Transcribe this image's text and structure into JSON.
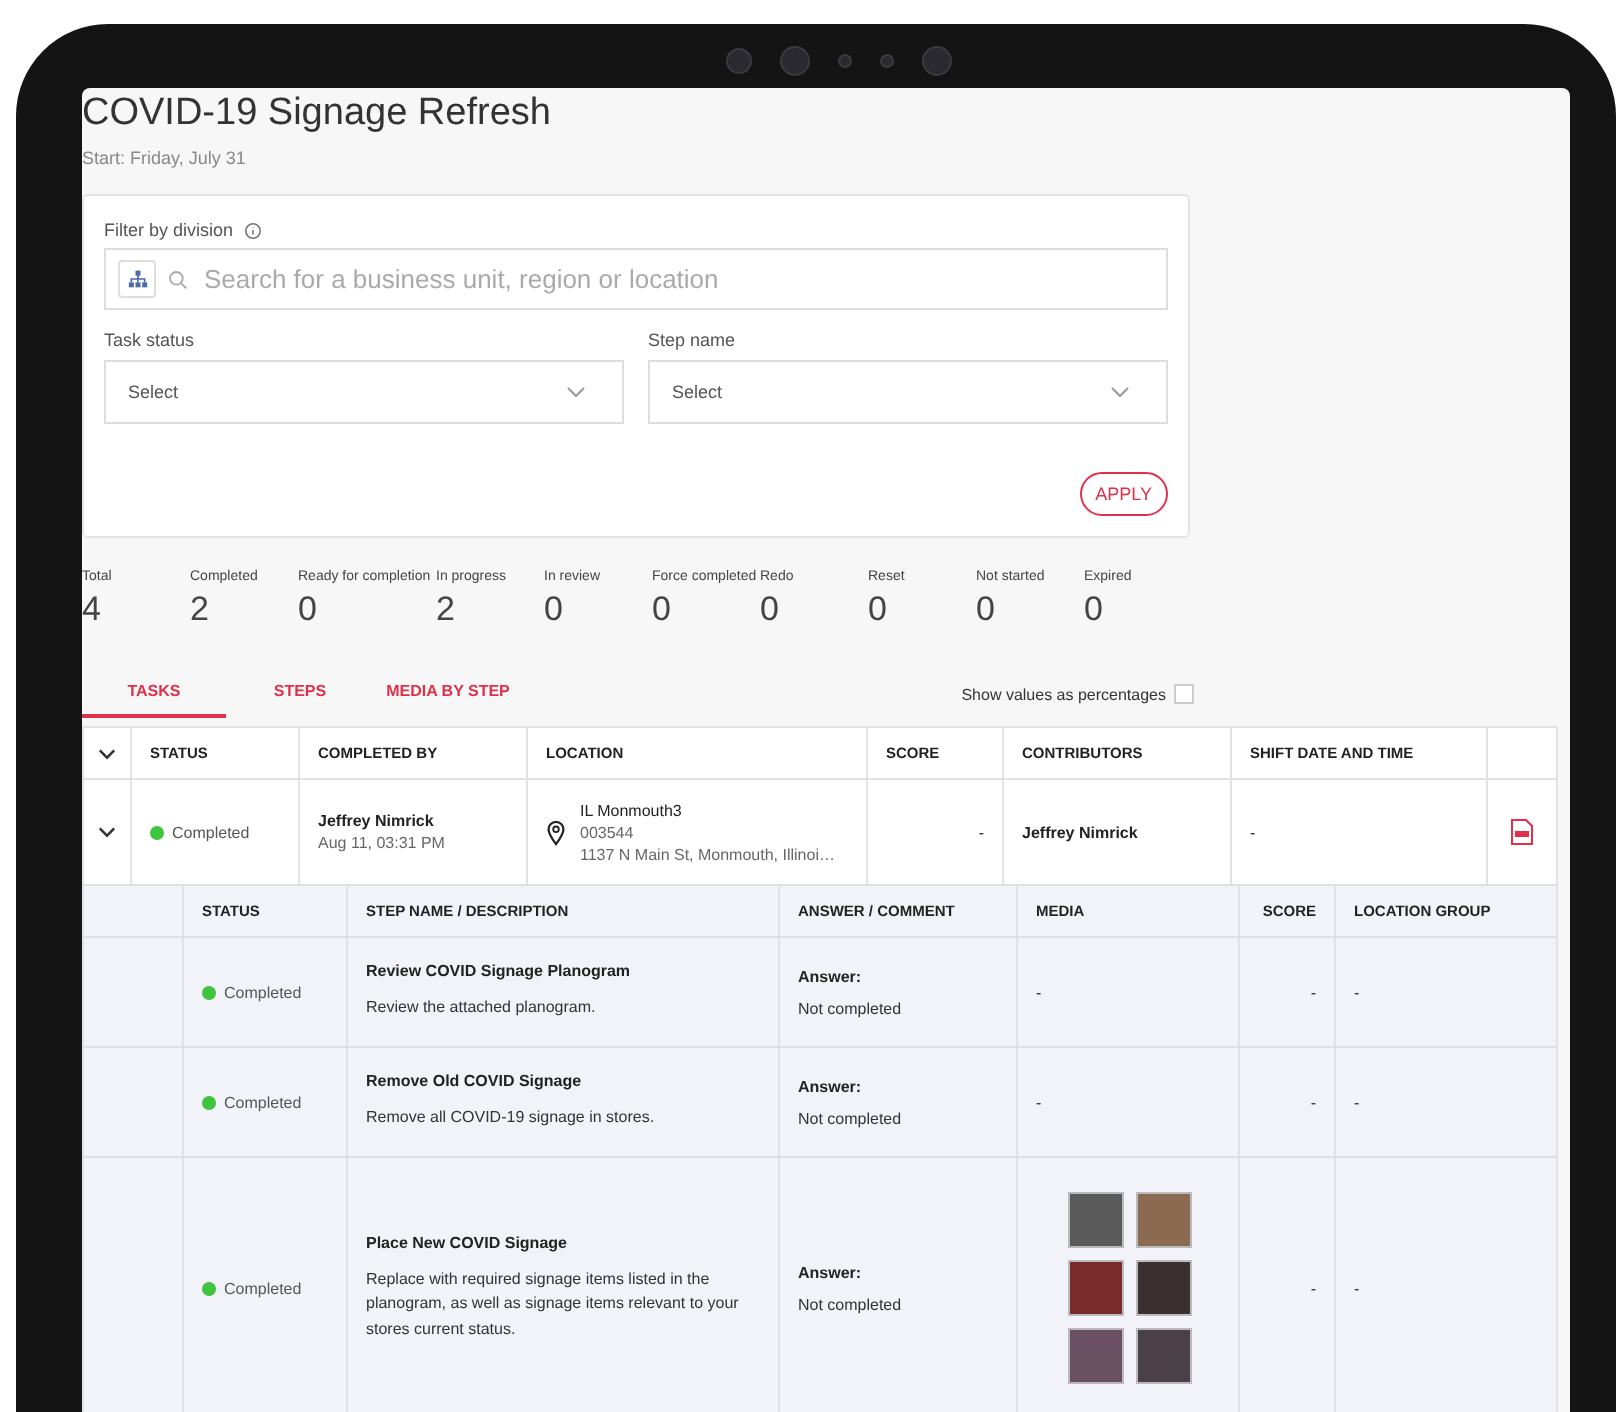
{
  "page": {
    "title": "COVID-19 Signage Refresh",
    "subtitle": "Start: Friday, July 31"
  },
  "filters": {
    "division_label": "Filter by division",
    "search_placeholder": "Search for a business unit, region or location",
    "selects": [
      {
        "label": "Task status",
        "value": "Select"
      },
      {
        "label": "Step name",
        "value": "Select"
      }
    ],
    "apply": "APPLY"
  },
  "stats": [
    {
      "label": "Total",
      "value": "4"
    },
    {
      "label": "Completed",
      "value": "2"
    },
    {
      "label": "Ready for completion",
      "value": "0"
    },
    {
      "label": "In progress",
      "value": "2"
    },
    {
      "label": "In review",
      "value": "0"
    },
    {
      "label": "Force completed",
      "value": "0"
    },
    {
      "label": "Redo",
      "value": "0"
    },
    {
      "label": "Reset",
      "value": "0"
    },
    {
      "label": "Not started",
      "value": "0"
    },
    {
      "label": "Expired",
      "value": "0"
    }
  ],
  "tabs": [
    {
      "label": "TASKS",
      "selected": true
    },
    {
      "label": "STEPS",
      "selected": false
    },
    {
      "label": "MEDIA BY STEP",
      "selected": false
    }
  ],
  "percentages": {
    "label": "Show values as percentages",
    "checked": false
  },
  "table": {
    "columns": [
      "STATUS",
      "COMPLETED BY",
      "LOCATION",
      "SCORE",
      "CONTRIBUTORS",
      "SHIFT DATE AND TIME"
    ],
    "rows": [
      {
        "expanded": true,
        "status": "Completed",
        "color": "#3ec43e",
        "completed_by": "Jeffrey Nimrick",
        "completed_at": "Aug 11, 03:31 PM",
        "location": "IL Monmouth3",
        "location_code": "003544",
        "address": "1137 N Main St, Monmouth, Illinoi…",
        "score": "-",
        "contributors": "Jeffrey Nimrick",
        "shift": "-",
        "steps": {
          "columns": [
            "STATUS",
            "STEP NAME / DESCRIPTION",
            "ANSWER / COMMENT",
            "MEDIA",
            "SCORE",
            "LOCATION GROUP"
          ],
          "rows": [
            {
              "status": "Completed",
              "color": "#3ec43e",
              "name": "Review COVID Signage Planogram",
              "description": "Review the attached planogram.",
              "answer_label": "Answer:",
              "answer": "Not completed",
              "media": {
                "kind": "text",
                "text": "-"
              },
              "score": "-",
              "location_group": "-"
            },
            {
              "status": "Completed",
              "color": "#3ec43e",
              "name": "Remove Old COVID Signage",
              "description": "Remove all COVID-19 signage in stores.",
              "answer_label": "Answer:",
              "answer": "Not completed",
              "media": {
                "kind": "text",
                "text": "-"
              },
              "score": "-",
              "location_group": "-"
            },
            {
              "status": "Completed",
              "color": "#3ec43e",
              "name": "Place New COVID Signage",
              "description": "Replace with required signage items listed in the planogram, as well as signage items relevant to your stores current status.",
              "answer_label": "Answer:",
              "answer": "Not completed",
              "media": {
                "kind": "photos",
                "items": [
                  {
                    "kind": "photo"
                  },
                  {
                    "kind": "photo"
                  },
                  {
                    "kind": "photo"
                  },
                  {
                    "kind": "photo"
                  },
                  {
                    "kind": "photo"
                  },
                  {
                    "kind": "photo"
                  }
                ]
              },
              "score": "-",
              "location_group": "-"
            }
          ]
        }
      }
    ]
  }
}
